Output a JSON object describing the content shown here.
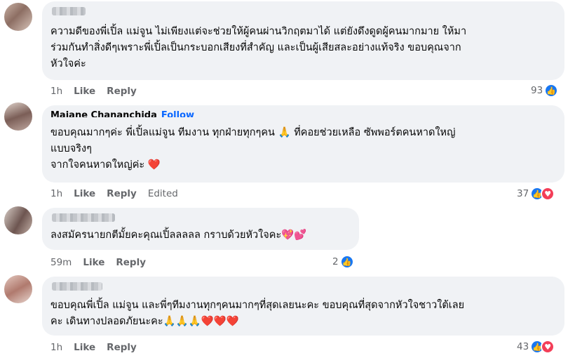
{
  "comments": [
    {
      "author": "",
      "text": "ความดีของพี่เปิ้ล แม่จูน ไม่เพียงแต่จะช่วยให้ผู้คนผ่านวิกฤตมาได้ แต่ยังดึงดูดผู้คนมากมาย ให้มา\nร่วมกันทำสิ่งดีๆเพราะพี่เปิ้ลเป็นกระบอกเสียงที่สำคัญ และเป็นผู้เสียสละอย่างแท้จริง ขอบคุณจาก\nหัวใจค่ะ",
      "time": "1h",
      "like_label": "Like",
      "reply_label": "Reply",
      "reaction_count": "93",
      "reactions": [
        "like-icon"
      ]
    },
    {
      "author": "Majane Chananchida",
      "follow_label": "Follow",
      "text": "ขอบคุณมากๆค่ะ พี่เปิ้ลแม่จูน ทีมงาน ทุกฝ่ายทุกๆคน 🙏 ที่คอยช่วยเหลือ ซัพพอร์ตคนหาดใหญ่\nแบบจริงๆ\nจากใจคนหาดใหญ่ค่ะ ",
      "heart": "❤️",
      "time": "1h",
      "like_label": "Like",
      "reply_label": "Reply",
      "edited_label": "Edited",
      "reaction_count": "37",
      "reactions": [
        "like-icon",
        "love-icon"
      ]
    },
    {
      "author": "",
      "text": "ลงสมัครนายกตีมั้ยคะคุณเปิ้ลลลลล กราบด้วยหัวใจคะ",
      "emoji": "💖💕",
      "time": "59m",
      "like_label": "Like",
      "reply_label": "Reply",
      "reaction_count": "2",
      "reactions": [
        "like-icon"
      ]
    },
    {
      "author": "",
      "text": "ขอบคุณพี่เปิ้ล แม่จูน และพี่ๆทีมงานทุกๆคนมากๆที่สุดเลยนะคะ ขอบคุณที่สุดจากหัวใจชาวใต้เลย\nคะ เดินทางปลอดภัยนะคะ🙏🙏🙏",
      "emoji": "❤️❤️❤️",
      "time": "1h",
      "like_label": "Like",
      "reply_label": "Reply",
      "reaction_count": "43",
      "reactions": [
        "like-icon",
        "love-icon"
      ]
    }
  ],
  "icons": {
    "like": "👍",
    "love": "♥"
  },
  "colors": {
    "link": "#0866ff",
    "bubble": "#f0f2f5",
    "like": "#1877f2",
    "love": "#f33e58"
  }
}
